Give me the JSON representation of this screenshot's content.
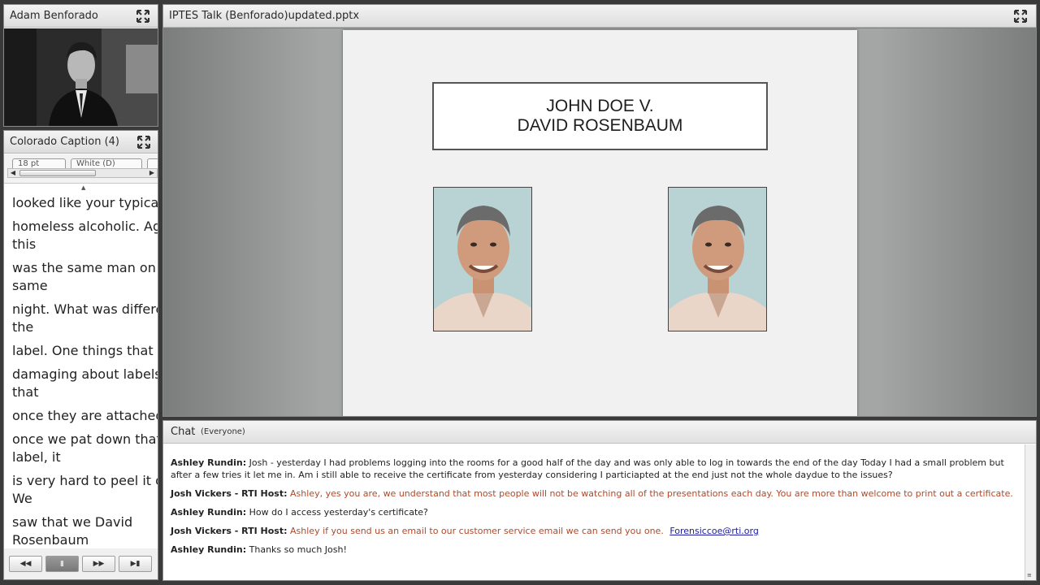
{
  "camera_pod": {
    "title": "Adam Benforado"
  },
  "caption_pod": {
    "title": "Colorado Caption (4)",
    "font_size_value": "18 pt",
    "color_value": "White (D)",
    "lines": [
      "looked like your typical",
      "homeless alcoholic. Again\nthis",
      "was the same man on the\nsame",
      "night. What was different was\nthe",
      "label. One things that is",
      "damaging about labels is\nthat",
      "once they are attached,",
      "once we pat down that\nlabel, it",
      "is very hard to peel it off.\nWe",
      "saw that we David\nRosenbaum"
    ],
    "nav_buttons": [
      "⏮",
      "▶",
      "⏭",
      "⏭"
    ]
  },
  "share_pod": {
    "title": "IPTES Talk (Benforado)updated.pptx",
    "slide": {
      "title_line1": "JOHN DOE V.",
      "title_line2": "DAVID ROSENBAUM"
    }
  },
  "chat_pod": {
    "title": "Chat",
    "scope": "(Everyone)",
    "messages": [
      {
        "sender": "Ashley Rundin:",
        "text": "Josh - yesterday I had problems logging into the rooms for a good half of the day and was only able to log in towards the end of the day Today I had a small problem but after a few tries it let me in. Am i still able to receive the certificate from yesterday considering I particiapted at the end just not the whole daydue to the issues?",
        "host": false
      },
      {
        "sender": "Josh Vickers - RTI Host:",
        "text": "Ashley, yes you are, we understand that most people will not be watching all of the presentations each day.  You are more than welcome to print out a certificate.",
        "host": true
      },
      {
        "sender": "Ashley Rundin:",
        "text": "How do I access yesterday's certificate?",
        "host": false
      },
      {
        "sender": "Josh Vickers - RTI Host:",
        "text": "Ashley if you send us an email to our customer service email we can send you one.",
        "host": true,
        "link": "Forensiccoe@rti.org"
      },
      {
        "sender": "Ashley Rundin:",
        "text": "Thanks so much Josh!",
        "host": false
      }
    ]
  },
  "icons": {
    "fullscreen": "fullscreen-icon",
    "scroll_left": "arrow-left-icon",
    "scroll_right": "arrow-right-icon"
  },
  "colors": {
    "host_text": "#b0492a",
    "link": "#1a1aa6"
  }
}
